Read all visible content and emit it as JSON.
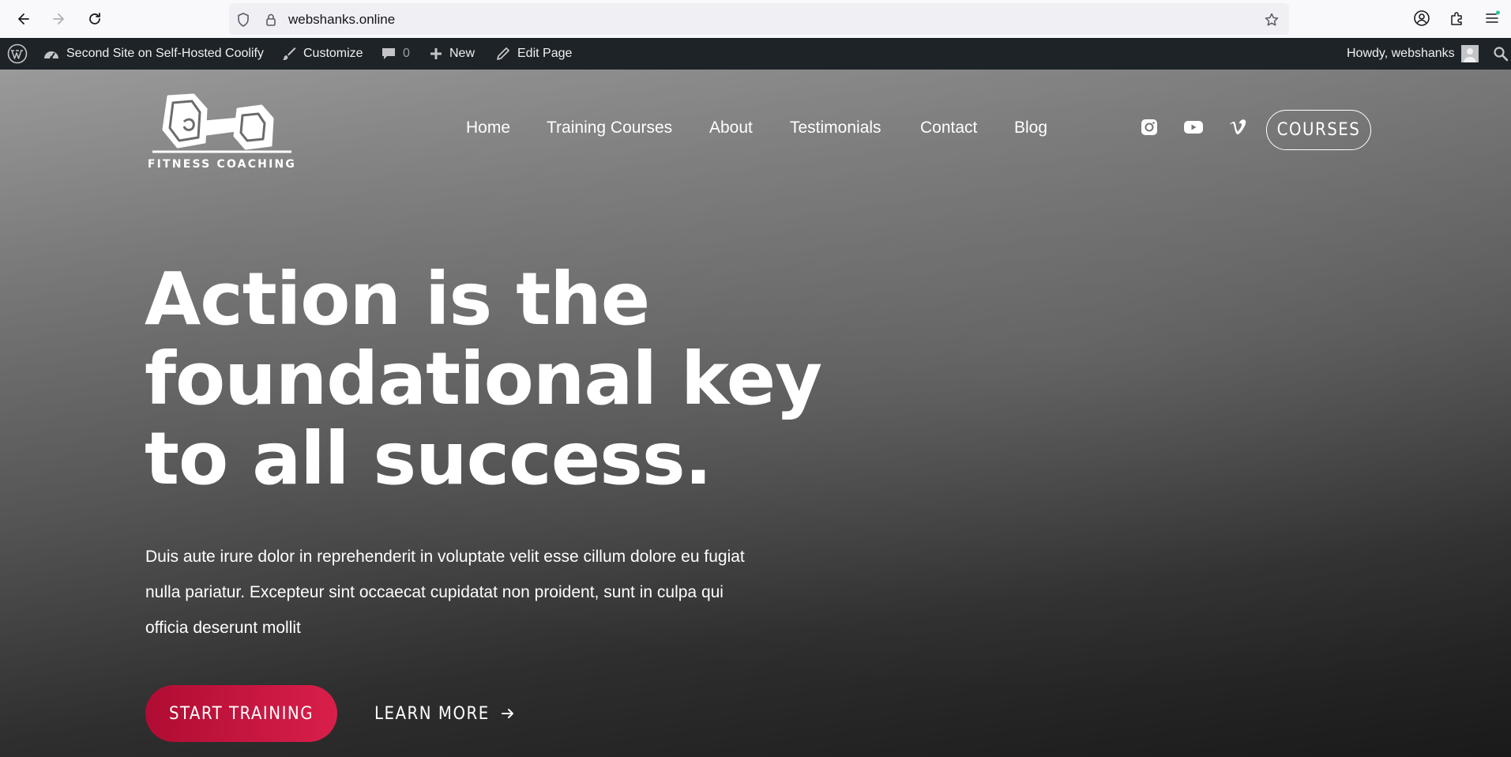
{
  "browser": {
    "url": "webshanks.online"
  },
  "admin_bar": {
    "site_name": "Second Site on Self-Hosted Coolify",
    "customize": "Customize",
    "comments_count": "0",
    "new": "New",
    "edit_page": "Edit Page",
    "howdy": "Howdy, webshanks"
  },
  "site": {
    "logo_text": "FITNESS COACHING",
    "nav": [
      {
        "label": "Home"
      },
      {
        "label": "Training Courses"
      },
      {
        "label": "About"
      },
      {
        "label": "Testimonials"
      },
      {
        "label": "Contact"
      },
      {
        "label": "Blog"
      }
    ],
    "social_icons": [
      "instagram-icon",
      "youtube-icon",
      "vimeo-icon"
    ],
    "courses_button": "COURSES"
  },
  "hero": {
    "headline_lines": [
      "Action is the",
      "foundational key",
      "to all success."
    ],
    "body": "Duis aute irure dolor in reprehenderit in voluptate velit esse cillum dolore eu fugiat nulla pariatur. Excepteur sint occaecat cupidatat non proident, sunt in culpa qui officia deserunt mollit",
    "primary_button": "START TRAINING",
    "secondary_button": "LEARN MORE"
  },
  "colors": {
    "admin_bar_bg": "#1d2327",
    "primary_button": "#c4143d"
  }
}
